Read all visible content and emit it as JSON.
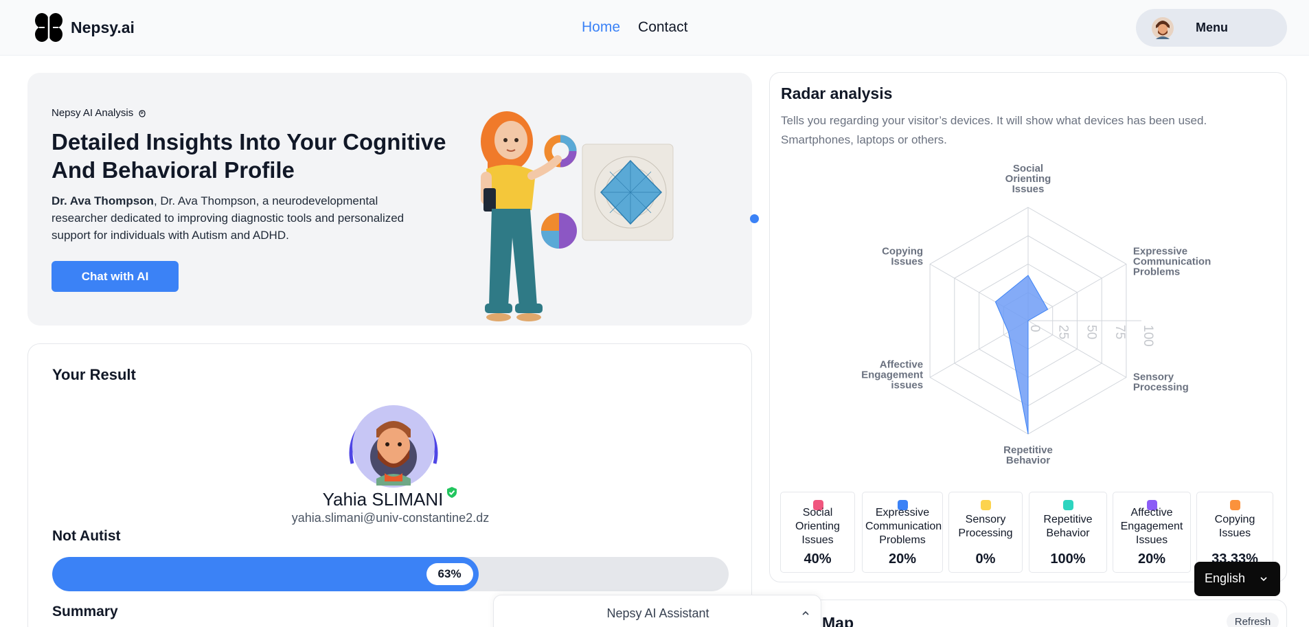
{
  "header": {
    "brand": "Nepsy.ai",
    "nav": {
      "home": "Home",
      "contact": "Contact"
    },
    "menu_label": "Menu",
    "accent": "#3b82f6"
  },
  "hero": {
    "eyebrow": "Nepsy AI Analysis",
    "title": "Detailed Insights Into Your Cognitive And Behavioral Profile",
    "author": "Dr. Ava Thompson",
    "description": ", Dr. Ava Thompson, a neurodevelopmental researcher dedicated to improving diagnostic tools and personalized support for individuals with Autism and ADHD.",
    "cta": "Chat with AI"
  },
  "result": {
    "title": "Your Result",
    "name": "Yahia SLIMANI",
    "email": "yahia.slimani@univ-constantine2.dz",
    "verdict": "Not Autist",
    "progress_percent": 63,
    "progress_label": "63%",
    "summary_label": "Summary"
  },
  "radar": {
    "title": "Radar analysis",
    "subtitle": "Tells you regarding your visitor’s devices. It will show what devices has been used. Smartphones, laptops or others.",
    "axis_labels": [
      "Social Orienting Issues",
      "Expressive Communication Problems",
      "Sensory Processing",
      "Repetitive Behavior",
      "Affective Engagement issues",
      "Copying Issues"
    ],
    "ticks": [
      "0",
      "25",
      "50",
      "75",
      "100"
    ],
    "stats": [
      {
        "label": "Social Orienting Issues",
        "value": "40%",
        "color": "#f0567e"
      },
      {
        "label": "Expressive Communication Problems",
        "value": "20%",
        "color": "#3b82f6"
      },
      {
        "label": "Sensory Processing",
        "value": "0%",
        "color": "#fcd34d"
      },
      {
        "label": "Repetitive Behavior",
        "value": "100%",
        "color": "#2dd4bf"
      },
      {
        "label": "Affective Engagement Issues",
        "value": "20%",
        "color": "#8b5cf6"
      },
      {
        "label": "Copying Issues",
        "value": "33.33%",
        "color": "#fb923c"
      }
    ]
  },
  "chart_data": {
    "type": "radar",
    "categories": [
      "Social Orienting Issues",
      "Expressive Communication Problems",
      "Sensory Processing",
      "Repetitive Behavior",
      "Affective Engagement issues",
      "Copying Issues"
    ],
    "values": [
      40,
      20,
      0,
      100,
      20,
      33.33
    ],
    "range": [
      0,
      100
    ],
    "ticks": [
      0,
      25,
      50,
      75,
      100
    ],
    "fill_color": "#6f9cf6"
  },
  "map": {
    "title": "Map",
    "refresh": "Refresh"
  },
  "assistant": {
    "label": "Nepsy AI Assistant"
  },
  "language": {
    "selected": "English"
  }
}
